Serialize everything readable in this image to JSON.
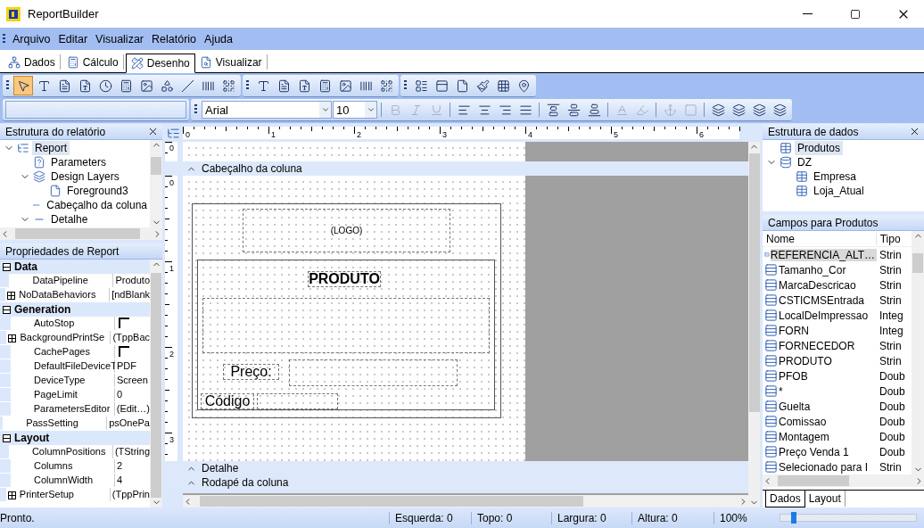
{
  "window": {
    "title": "ReportBuilder"
  },
  "menu": [
    "Arquivo",
    "Editar",
    "Visualizar",
    "Relatório",
    "Ajuda"
  ],
  "tabs": [
    {
      "label": "Dados",
      "kind": "data",
      "selected": false
    },
    {
      "label": "Cálculo",
      "kind": "calc",
      "selected": false
    },
    {
      "label": "Desenho",
      "kind": "design",
      "selected": true
    },
    {
      "label": "Visualizar",
      "kind": "preview",
      "selected": false
    }
  ],
  "tools": [
    [
      {
        "kind": "pointer",
        "selected": true
      },
      {
        "kind": "label",
        "selected": false
      },
      {
        "kind": "memo",
        "selected": false
      },
      {
        "kind": "richtext",
        "selected": false
      },
      {
        "kind": "sysvar",
        "selected": false
      },
      {
        "kind": "calc",
        "selected": false
      },
      {
        "kind": "image",
        "selected": false
      },
      {
        "kind": "shape",
        "selected": false
      },
      {
        "kind": "line",
        "selected": false
      },
      {
        "kind": "barcode",
        "selected": false
      },
      {
        "kind": "qrcode",
        "selected": false
      }
    ],
    [
      {
        "kind": "label",
        "selected": false
      },
      {
        "kind": "memo",
        "selected": false
      },
      {
        "kind": "richtext",
        "selected": false
      },
      {
        "kind": "calc",
        "selected": false
      },
      {
        "kind": "image",
        "selected": false
      },
      {
        "kind": "barcode",
        "selected": false
      },
      {
        "kind": "qrcode",
        "selected": false
      }
    ],
    [
      {
        "kind": "region",
        "selected": false
      },
      {
        "kind": "subreport",
        "selected": false
      },
      {
        "kind": "page",
        "selected": false
      },
      {
        "kind": "brush",
        "selected": false
      },
      {
        "kind": "crosstab",
        "selected": false
      },
      {
        "kind": "map",
        "selected": false
      }
    ]
  ],
  "format_bar": {
    "font": "Arial",
    "size": "10",
    "tools": [
      {
        "kind": "bold",
        "disabled": true
      },
      {
        "kind": "italic",
        "disabled": true
      },
      {
        "kind": "underline",
        "disabled": true
      },
      {
        "kind": "sep"
      },
      {
        "kind": "align-left",
        "disabled": false
      },
      {
        "kind": "align-center",
        "disabled": false
      },
      {
        "kind": "align-right",
        "disabled": false
      },
      {
        "kind": "align-justify",
        "disabled": false
      },
      {
        "kind": "sep"
      },
      {
        "kind": "valign-top",
        "disabled": false
      },
      {
        "kind": "valign-middle",
        "disabled": false
      },
      {
        "kind": "valign-bottom",
        "disabled": false
      },
      {
        "kind": "sep"
      },
      {
        "kind": "font-color",
        "disabled": true
      },
      {
        "kind": "highlight",
        "disabled": true
      },
      {
        "kind": "sep"
      },
      {
        "kind": "anchor",
        "disabled": true
      },
      {
        "kind": "grid",
        "disabled": true
      },
      {
        "kind": "sep"
      },
      {
        "kind": "bring-front",
        "disabled": false
      },
      {
        "kind": "send-back",
        "disabled": false
      },
      {
        "kind": "forward",
        "disabled": false
      },
      {
        "kind": "backward",
        "disabled": false
      }
    ]
  },
  "report_tree": {
    "title": "Estrutura do relatório",
    "items": [
      {
        "label": "Report",
        "kind": "report",
        "selected": true,
        "expanded": true,
        "children": [
          {
            "label": "Parameters",
            "kind": "parameters",
            "selected": false
          },
          {
            "label": "Design Layers",
            "kind": "layers",
            "selected": false,
            "expanded": true,
            "children": [
              {
                "label": "Foreground3",
                "kind": "layer",
                "selected": false
              }
            ]
          },
          {
            "label": "Cabeçalho da coluna",
            "kind": "band",
            "selected": false
          },
          {
            "label": "Detalhe",
            "kind": "band",
            "selected": false,
            "expanded": true
          }
        ]
      }
    ]
  },
  "properties": {
    "title": "Propriedades de Report",
    "categories": [
      {
        "name": "Data",
        "expanded": true,
        "rows": [
          {
            "name": "DataPipeline",
            "value": "Produto"
          },
          {
            "name": "NoDataBehaviors",
            "value": "[ndBlank",
            "expanded": false
          }
        ]
      },
      {
        "name": "Generation",
        "expanded": true,
        "rows": [
          {
            "name": "AutoStop",
            "kind": "check",
            "checked": false
          },
          {
            "name": "BackgroundPrintSe",
            "value": "(TppBac",
            "expanded": false
          },
          {
            "name": "CachePages",
            "kind": "check",
            "checked": false
          },
          {
            "name": "DefaultFileDeviceT",
            "value": "PDF"
          },
          {
            "name": "DeviceType",
            "value": "Screen"
          },
          {
            "name": "PageLimit",
            "value": "0"
          },
          {
            "name": "ParametersEditor",
            "value": "(Edit…)"
          },
          {
            "name": "PassSetting",
            "value": "psOnePa"
          }
        ]
      },
      {
        "name": "Layout",
        "expanded": true,
        "rows": [
          {
            "name": "ColumnPositions",
            "value": "(TString"
          },
          {
            "name": "Columns",
            "value": "2"
          },
          {
            "name": "ColumnWidth",
            "value": "4"
          },
          {
            "name": "PrinterSetup",
            "value": "(TppPrin",
            "expanded": false
          }
        ]
      }
    ]
  },
  "designer": {
    "h_ruler": [
      "0",
      "1",
      "2",
      "3",
      "4",
      "5",
      "6"
    ],
    "bands": [
      {
        "label": "Cabeçalho da coluna",
        "expanded": true,
        "ruler": [
          "0",
          "1",
          "2",
          "3"
        ]
      },
      {
        "label": "Detalhe",
        "expanded": true
      },
      {
        "label": "Rodapé da coluna",
        "expanded": true
      }
    ],
    "top_ruler": [
      "0"
    ],
    "logo": "(LOGO)",
    "title": "PRODUTO",
    "price_label": "Preço:",
    "code_label": "Código"
  },
  "data_tree": {
    "title": "Estrutura de dados",
    "items": [
      {
        "label": "Produtos",
        "kind": "table",
        "selected": true
      },
      {
        "label": "DZ",
        "kind": "database",
        "selected": false,
        "expanded": true,
        "children": [
          {
            "label": "Empresa",
            "kind": "table",
            "selected": false
          },
          {
            "label": "Loja_Atual",
            "kind": "table",
            "selected": false
          }
        ]
      }
    ]
  },
  "fields": {
    "title": "Campos para Produtos",
    "columns": [
      "Nome",
      "Tipo"
    ],
    "rows": [
      {
        "name": "REFERENCIA_ALT…",
        "type": "Strin",
        "selected": true
      },
      {
        "name": "Tamanho_Cor",
        "type": "Strin",
        "selected": false
      },
      {
        "name": "MarcaDescricao",
        "type": "Strin",
        "selected": false
      },
      {
        "name": "CSTICMSEntrada",
        "type": "Strin",
        "selected": false
      },
      {
        "name": "LocalDeImpressao",
        "type": "Integ",
        "selected": false
      },
      {
        "name": "FORN",
        "type": "Integ",
        "selected": false
      },
      {
        "name": "FORNECEDOR",
        "type": "Strin",
        "selected": false
      },
      {
        "name": "PRODUTO",
        "type": "Strin",
        "selected": false
      },
      {
        "name": "PFOB",
        "type": "Doub",
        "selected": false
      },
      {
        "name": "*",
        "type": "Doub",
        "selected": false
      },
      {
        "name": "Guelta",
        "type": "Doub",
        "selected": false
      },
      {
        "name": "Comissao",
        "type": "Doub",
        "selected": false
      },
      {
        "name": "Montagem",
        "type": "Doub",
        "selected": false
      },
      {
        "name": "Preço Venda 1",
        "type": "Doub",
        "selected": false
      },
      {
        "name": "Selecionado para I",
        "type": "Strin",
        "selected": false
      }
    ]
  },
  "panel_tabs": [
    {
      "label": "Dados",
      "selected": true
    },
    {
      "label": "Layout",
      "selected": false
    }
  ],
  "status": {
    "message": "Pronto.",
    "fields": [
      "Esquerda: 0",
      "Topo: 0",
      "Largura: 0",
      "Altura: 0"
    ],
    "zoom": "100%",
    "zoom_slider": {
      "level": 0.1
    }
  }
}
